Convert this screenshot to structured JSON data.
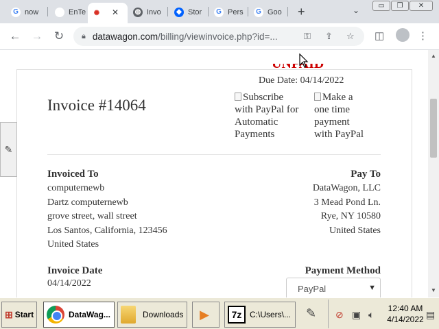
{
  "tabs": [
    {
      "label": "now",
      "icon": "google-icon"
    },
    {
      "label": "EnTe",
      "icon": "app-icon"
    },
    {
      "label": "",
      "icon": "star-spinner-icon",
      "active": true
    },
    {
      "label": "Invo",
      "icon": "globe-icon"
    },
    {
      "label": "Stor",
      "icon": "dropbox-icon"
    },
    {
      "label": "Pers",
      "icon": "google-icon"
    },
    {
      "label": "Goo",
      "icon": "google-icon"
    }
  ],
  "toolbar": {
    "url_host": "datawagon.com",
    "url_path": "/billing/viewinvoice.php?id=..."
  },
  "invoice": {
    "status_text": "UNPAID",
    "due_date": "Due Date: 04/14/2022",
    "title": "Invoice #14064",
    "subscribe_link": [
      "Subscribe",
      "with PayPal for",
      "Automatic",
      "Payments"
    ],
    "payment_link": [
      "Make a",
      "one time",
      "payment",
      "with PayPal"
    ],
    "invoiced_to": {
      "heading": "Invoiced To",
      "lines": [
        "computernewb",
        "Dartz computernewb",
        "grove street, wall street",
        "Los Santos, California, 123456",
        "United States"
      ]
    },
    "pay_to": {
      "heading": "Pay To",
      "lines": [
        "DataWagon, LLC",
        "3 Mead Pond Ln.",
        "Rye, NY 10580",
        "United States"
      ]
    },
    "invoice_date": {
      "heading": "Invoice Date",
      "value": "04/14/2022"
    },
    "payment_method": {
      "heading": "Payment Method",
      "selected": "PayPal"
    }
  },
  "taskbar": {
    "start_label": "Start",
    "buttons": [
      {
        "label": "DataWag...",
        "icon": "chrome-icon"
      },
      {
        "label": "Downloads",
        "icon": "folder-icon"
      },
      {
        "label": "",
        "icon": "media-player-icon"
      },
      {
        "label": "C:\\Users\\...",
        "icon": "7zip-icon"
      }
    ],
    "clock_time": "12:40 AM",
    "clock_date": "4/14/2022"
  },
  "colors": {
    "unpaid": "#cc0000",
    "tab_strip": "#dee1e6",
    "taskbar": "#ece9d8"
  }
}
